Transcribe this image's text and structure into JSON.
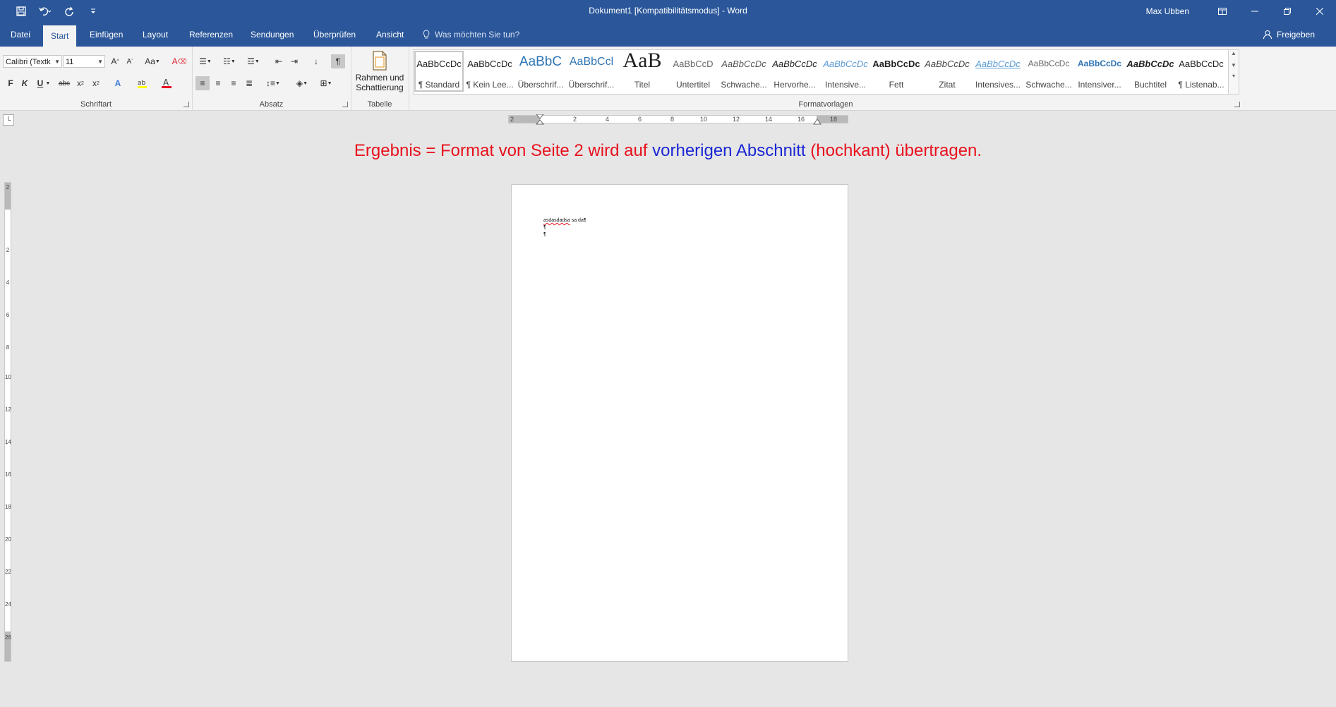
{
  "titlebar": {
    "title": "Dokument1 [Kompatibilitätsmodus]  -  Word",
    "user": "Max Ubben",
    "qat_icons": [
      "save-icon",
      "undo-icon",
      "redo-icon",
      "customize-icon"
    ]
  },
  "tabs": {
    "items": [
      {
        "label": "Datei"
      },
      {
        "label": "Start"
      },
      {
        "label": "Einfügen"
      },
      {
        "label": "Layout"
      },
      {
        "label": "Referenzen"
      },
      {
        "label": "Sendungen"
      },
      {
        "label": "Überprüfen"
      },
      {
        "label": "Ansicht"
      }
    ],
    "active": "Start",
    "tellme": "Was möchten Sie tun?",
    "share": "Freigeben"
  },
  "ribbon": {
    "font": {
      "name": "Calibri (Textk",
      "size": "11",
      "label": "Schriftart"
    },
    "paragraph": {
      "label": "Absatz"
    },
    "table": {
      "button_line1": "Rahmen und",
      "button_line2": "Schattierung",
      "label": "Tabelle"
    },
    "styles": {
      "label": "Formatvorlagen",
      "items": [
        {
          "sample": "AaBbCcDc",
          "name": "¶ Standard"
        },
        {
          "sample": "AaBbCcDc",
          "name": "¶ Kein Lee..."
        },
        {
          "sample": "AaBbC",
          "name": "Überschrif..."
        },
        {
          "sample": "AaBbCcl",
          "name": "Überschrif..."
        },
        {
          "sample": "AaB",
          "name": "Titel"
        },
        {
          "sample": "AaBbCcD",
          "name": "Untertitel"
        },
        {
          "sample": "AaBbCcDc",
          "name": "Schwache..."
        },
        {
          "sample": "AaBbCcDc",
          "name": "Hervorhe..."
        },
        {
          "sample": "AaBbCcDc",
          "name": "Intensive..."
        },
        {
          "sample": "AaBbCcDc",
          "name": "Fett"
        },
        {
          "sample": "AaBbCcDc",
          "name": "Zitat"
        },
        {
          "sample": "AaBbCcDc",
          "name": "Intensives..."
        },
        {
          "sample": "AaBbCcDc",
          "name": "Schwache..."
        },
        {
          "sample": "AaBbCcDc",
          "name": "Intensiver..."
        },
        {
          "sample": "AaBbCcDc",
          "name": "Buchtitel"
        },
        {
          "sample": "AaBbCcDc",
          "name": "¶ Listenab..."
        }
      ]
    }
  },
  "ruler": {
    "h_ticks": [
      "2",
      "2",
      "4",
      "6",
      "8",
      "10",
      "12",
      "14",
      "16",
      "18"
    ],
    "v_ticks": [
      "2",
      "2",
      "4",
      "6",
      "8",
      "10",
      "12",
      "14",
      "16",
      "18",
      "20",
      "22",
      "24",
      "26"
    ]
  },
  "annotation": {
    "part1": "Ergebnis = Format von Seite 2 wird auf ",
    "part2": "vorherigen Abschnitt",
    "part3": " (hochkant) übertragen."
  },
  "document": {
    "line1_misspelled": "asdasdadsa",
    "line1_rest": " sa da¶",
    "line2": "¶",
    "line3": "¶"
  },
  "colors": {
    "accent": "#2b579a",
    "annotation_red": "#e8111d",
    "annotation_blue": "#1a26d4",
    "background": "#e6e6e6"
  }
}
